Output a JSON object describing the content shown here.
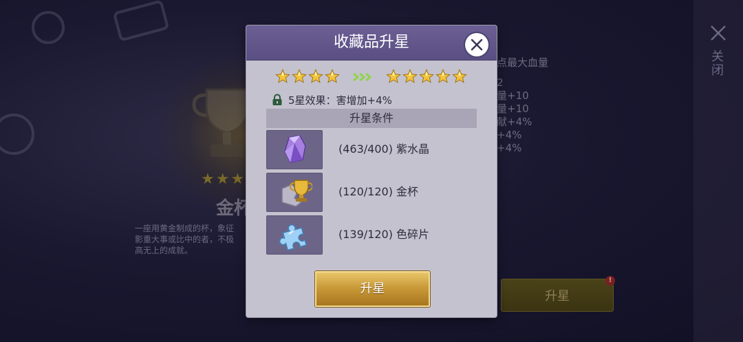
{
  "background": {
    "item_stars": "★★★",
    "item_name": "金杯",
    "description_lines": [
      "一座用黄金制成的杯，象征",
      "影重大事或比中的者，不极",
      "高无上的成就。"
    ],
    "stats": [
      "点最大血量",
      "2",
      "量+10",
      "量+10",
      "献+4%",
      "+4%",
      "+4%"
    ],
    "upgrade_label": "升星",
    "notification_badge": "!",
    "close_label": "关闭"
  },
  "dialog": {
    "title": "收藏品升星",
    "stars_before": 4,
    "stars_after": 5,
    "effect_text": "5星效果：害增加+4%",
    "conditions_header": "升星条件",
    "requirements": [
      {
        "icon": "amethyst-crystal-icon",
        "text": "(463/400) 紫水晶"
      },
      {
        "icon": "golden-cup-icon",
        "text": "(120/120) 金杯"
      },
      {
        "icon": "puzzle-piece-icon",
        "text": "(139/120) 色碎片"
      }
    ],
    "upgrade_label": "升星"
  },
  "colors": {
    "header_purple": "#5f5489",
    "dialog_bg": "#c5c2cf",
    "star_gold": "#f2c43c",
    "arrow_green": "#8fd44a",
    "button_gold": "#c99a39"
  }
}
